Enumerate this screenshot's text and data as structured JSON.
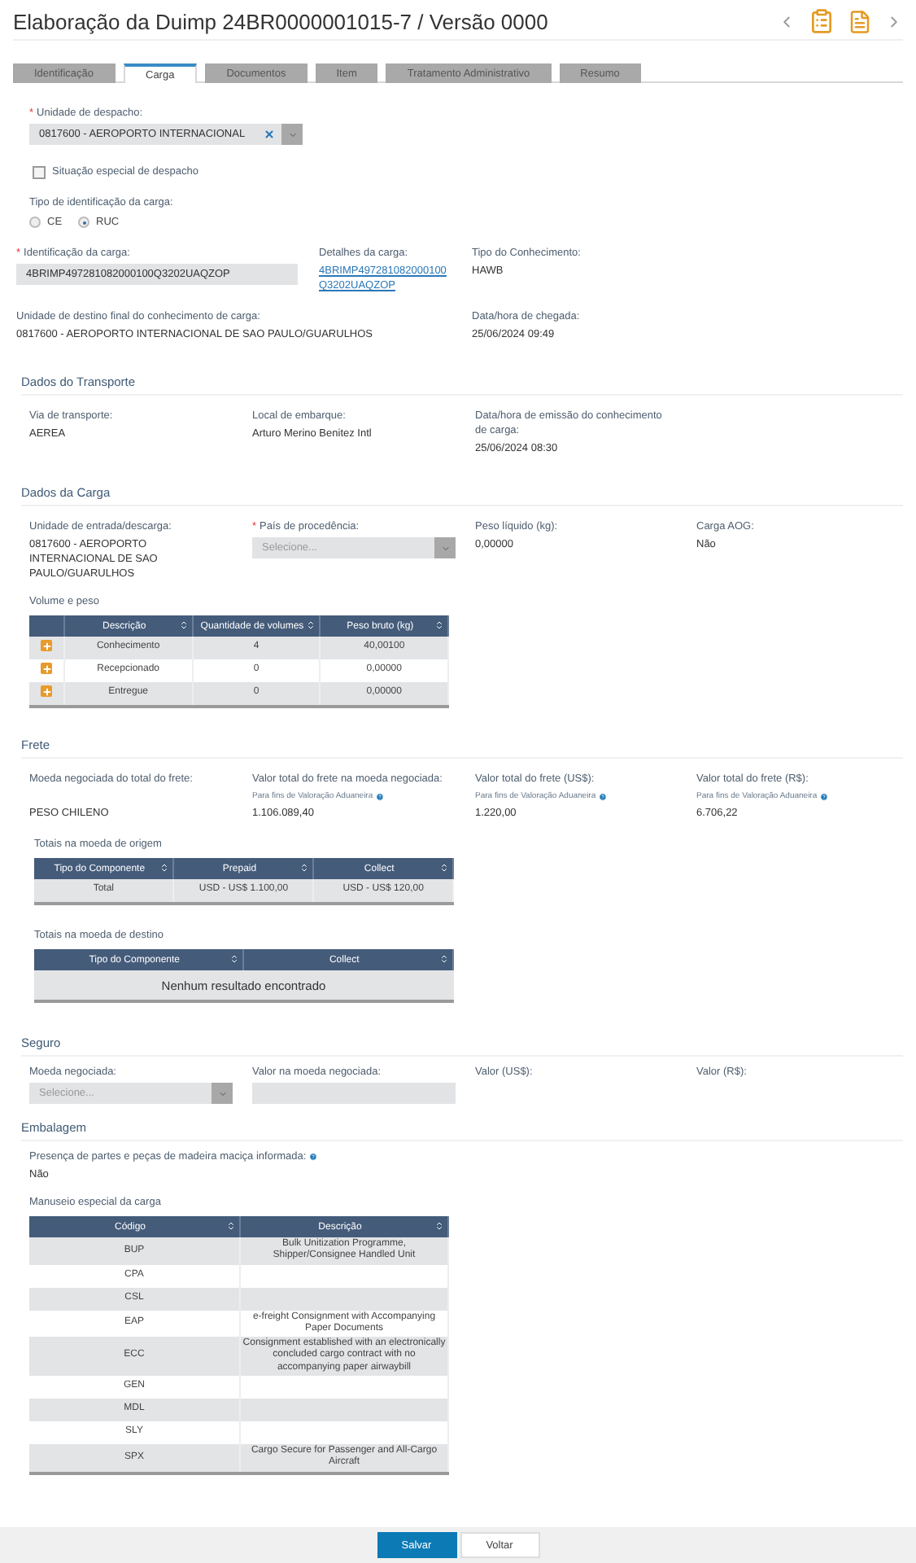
{
  "title": "Elaboração da Duimp 24BR0000001015-7 / Versão 0000",
  "tabs": [
    {
      "label": "Identificação",
      "selected": false
    },
    {
      "label": "Carga",
      "selected": true
    },
    {
      "label": "Documentos",
      "selected": false
    },
    {
      "label": "Item",
      "selected": false
    },
    {
      "label": "Tratamento Administrativo",
      "selected": false
    },
    {
      "label": "Resumo",
      "selected": false
    }
  ],
  "dispatch_unit": {
    "required_mark": "*",
    "label": "Unidade de despacho:",
    "value": "0817600 - AEROPORTO INTERNACIONAL"
  },
  "special_dispatch": {
    "label": "Situação especial de despacho",
    "checked": false
  },
  "cargo_id_type": {
    "label": "Tipo de identificação da carga:",
    "options": [
      {
        "label": "CE",
        "selected": false
      },
      {
        "label": "RUC",
        "selected": true
      }
    ]
  },
  "cargo_id": {
    "required_mark": "*",
    "label": "Identificação da carga:",
    "value": "4BRIMP497281082000100Q3202UAQZOP"
  },
  "cargo_details": {
    "label": "Detalhes da carga:",
    "value": "4BRIMP497281082000100Q3202UAQZOP"
  },
  "bill_type": {
    "label": "Tipo do Conhecimento:",
    "value": "HAWB"
  },
  "destination_unit": {
    "label": "Unidade de destino final do conhecimento de carga:",
    "value": "0817600 - AEROPORTO INTERNACIONAL DE SAO PAULO/GUARULHOS"
  },
  "arrival": {
    "label": "Data/hora de chegada:",
    "value": "25/06/2024 09:49"
  },
  "transport": {
    "title": "Dados do Transporte",
    "fields": [
      {
        "label": "Via de transporte:",
        "value": "AEREA"
      },
      {
        "label": "Local de embarque:",
        "value": "Arturo Merino Benitez Intl"
      },
      {
        "label": "Data/hora de emissão do conhecimento de carga:",
        "value": "25/06/2024 08:30"
      }
    ]
  },
  "cargo_data": {
    "title": "Dados da Carga",
    "fields": [
      {
        "kind": "text",
        "label": "Unidade de entrada/descarga:",
        "value": "0817600 - AEROPORTO INTERNACIONAL DE SAO PAULO/GUARULHOS"
      },
      {
        "kind": "select",
        "required_mark": "*",
        "label": "País de procedência:",
        "placeholder": "Selecione..."
      },
      {
        "kind": "text",
        "label": "Peso líquido (kg):",
        "value": "0,00000"
      },
      {
        "kind": "text",
        "label": "Carga AOG:",
        "value": "Não"
      }
    ],
    "volume_table": {
      "title": "Volume e peso",
      "columns": [
        "Descrição",
        "Quantidade de volumes",
        "Peso bruto (kg)"
      ],
      "rows": [
        [
          "Conhecimento",
          "4",
          "40,00100"
        ],
        [
          "Recepcionado",
          "0",
          "0,00000"
        ],
        [
          "Entregue",
          "0",
          "0,00000"
        ]
      ]
    }
  },
  "freight": {
    "title": "Frete",
    "fields": [
      {
        "label": "Moeda negociada do total do frete:",
        "value": "PESO CHILENO"
      },
      {
        "label": "Valor total do frete na moeda negociada:",
        "note": "Para fins de Valoração Aduaneira",
        "value": "1.106.089,40"
      },
      {
        "label": "Valor total do frete (US$):",
        "note": "Para fins de Valoração Aduaneira",
        "value": "1.220,00"
      },
      {
        "label": "Valor total do frete (R$):",
        "note": "Para fins de Valoração Aduaneira",
        "value": "6.706,22"
      }
    ],
    "origin_table": {
      "title": "Totais na moeda de origem",
      "columns": [
        "Tipo do Componente",
        "Prepaid",
        "Collect"
      ],
      "rows": [
        [
          "Total",
          "USD - US$ 1.100,00",
          "USD - US$ 120,00"
        ]
      ]
    },
    "destination_table": {
      "title": "Totais na moeda de destino",
      "columns": [
        "Tipo do Componente",
        "Collect"
      ],
      "empty": "Nenhum resultado encontrado"
    }
  },
  "insurance": {
    "title": "Seguro",
    "fields": [
      {
        "kind": "select",
        "label": "Moeda negociada:",
        "placeholder": "Selecione..."
      },
      {
        "kind": "input",
        "label": "Valor na moeda negociada:"
      },
      {
        "kind": "text",
        "label": "Valor (US$):"
      },
      {
        "kind": "text",
        "label": "Valor (R$):"
      }
    ]
  },
  "packaging": {
    "title": "Embalagem",
    "question": "Presença de partes e peças de madeira maciça informada:",
    "answer": "Não",
    "handling": {
      "title": "Manuseio especial da carga",
      "columns": [
        "Código",
        "Descrição"
      ],
      "rows": [
        [
          "BUP",
          "Bulk Unitization Programme, Shipper/Consignee Handled Unit"
        ],
        [
          "CPA",
          ""
        ],
        [
          "CSL",
          ""
        ],
        [
          "EAP",
          "e-freight Consignment with Accompanying Paper Documents"
        ],
        [
          "ECC",
          "Consignment established with an electronically concluded cargo contract with no accompanying paper airwaybill"
        ],
        [
          "GEN",
          ""
        ],
        [
          "MDL",
          ""
        ],
        [
          "SLY",
          ""
        ],
        [
          "SPX",
          "Cargo Secure for Passenger and All-Cargo Aircraft"
        ]
      ]
    }
  },
  "buttons": [
    {
      "label": "Salvar",
      "primary": true
    },
    {
      "label": "Voltar",
      "primary": false
    }
  ]
}
